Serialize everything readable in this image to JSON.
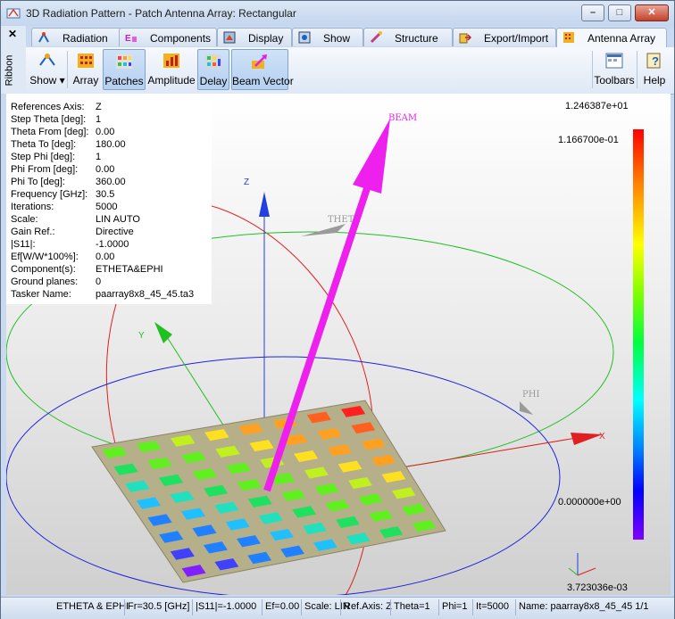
{
  "window": {
    "title": "3D Radiation Pattern - Patch Antenna Array: Rectangular",
    "app_icon": "radiation-pattern-icon",
    "controls": {
      "minimize": "–",
      "maximize": "□",
      "close": "✕"
    }
  },
  "sidebar": {
    "close_glyph": "✕",
    "label": "Ribbon"
  },
  "tabs": [
    {
      "label": "Radiation",
      "icon": "radiation-icon"
    },
    {
      "label": "Components",
      "icon": "components-icon"
    },
    {
      "label": "Display",
      "icon": "display-icon"
    },
    {
      "label": "Show",
      "icon": "show-icon"
    },
    {
      "label": "Structure",
      "icon": "structure-icon"
    },
    {
      "label": "Export/Import",
      "icon": "export-import-icon"
    },
    {
      "label": "Antenna Array",
      "icon": "antenna-array-icon",
      "active": true
    }
  ],
  "ribbon": {
    "show": "Show",
    "array": "Array",
    "patches": "Patches",
    "amplitude": "Amplitude",
    "delay": "Delay",
    "beam_vector": "Beam Vector",
    "toolbars": "Toolbars",
    "help": "Help"
  },
  "info": [
    {
      "key": "References Axis:",
      "value": "Z"
    },
    {
      "key": "Step Theta [deg]:",
      "value": "1"
    },
    {
      "key": "Theta From [deg]:",
      "value": "0.00"
    },
    {
      "key": "Theta To [deg]:",
      "value": "180.00"
    },
    {
      "key": "Step Phi [deg]:",
      "value": "1"
    },
    {
      "key": "Phi From [deg]:",
      "value": "0.00"
    },
    {
      "key": "Phi To [deg]:",
      "value": "360.00"
    },
    {
      "key": "Frequency [GHz]:",
      "value": "30.5"
    },
    {
      "key": "Iterations:",
      "value": "5000"
    },
    {
      "key": "Scale:",
      "value": "LIN AUTO"
    },
    {
      "key": "Gain Ref.:",
      "value": "Directive"
    },
    {
      "key": "|S11|:",
      "value": "-1.0000"
    },
    {
      "key": "Ef[W/W*100%]:",
      "value": "0.00"
    },
    {
      "key": "Component(s):",
      "value": "ETHETA&EPHI"
    },
    {
      "key": "Ground planes:",
      "value": "0"
    },
    {
      "key": "Tasker Name:",
      "value": "paarray8x8_45_45.ta3"
    }
  ],
  "scale": {
    "max": "1.246387e+01",
    "sub": "1.166700e-01",
    "zero": "0.000000e+00",
    "min": "3.723036e-03"
  },
  "axes": {
    "x": "X",
    "y": "Y",
    "z": "Z",
    "theta": "THETA",
    "phi": "PHI",
    "beam": "BEAM"
  },
  "status": [
    "ETHETA & EPHI",
    "Fr=30.5 [GHz]",
    "|S11|=-1.0000",
    "Ef=0.00",
    "Scale: LIN",
    "Ref.Axis: Z",
    "Theta=1",
    "Phi=1",
    "It=5000",
    "Name: paarray8x8_45_45 1/1"
  ]
}
